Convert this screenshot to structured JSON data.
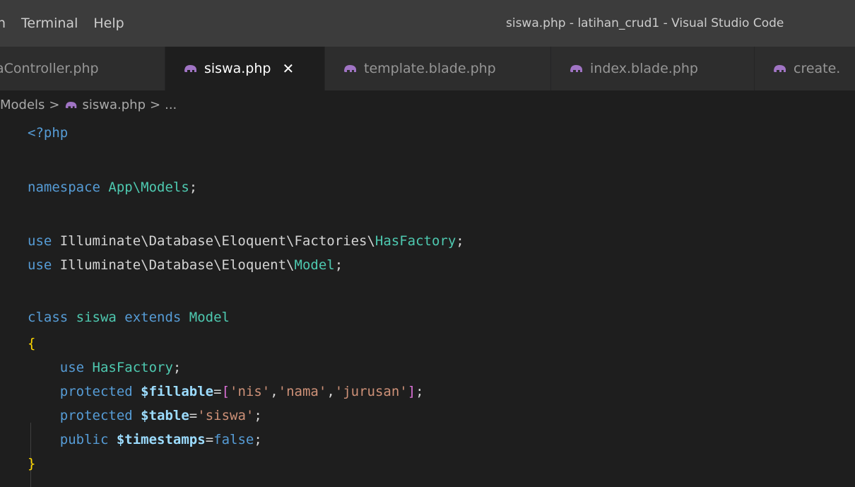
{
  "titlebar": {
    "menu": [
      "n",
      "Terminal",
      "Help"
    ],
    "window_title": "siswa.php - latihan_crud1 - Visual Studio Code"
  },
  "tabs": [
    {
      "label": "aController.php",
      "active": false,
      "icon": ""
    },
    {
      "label": "siswa.php",
      "active": true,
      "icon": "php-elephant-icon",
      "close": "✕"
    },
    {
      "label": "template.blade.php",
      "active": false,
      "icon": "php-elephant-icon"
    },
    {
      "label": "index.blade.php",
      "active": false,
      "icon": "php-elephant-icon"
    },
    {
      "label": "create.",
      "active": false,
      "icon": "php-elephant-icon"
    }
  ],
  "breadcrumb": {
    "folder": "Models",
    "file": "siswa.php",
    "symbol": "...",
    "separator": ">"
  },
  "editor": {
    "lines": [
      [
        {
          "t": "<?php",
          "c": "kw"
        }
      ],
      [],
      [
        {
          "t": "namespace ",
          "c": "kw"
        },
        {
          "t": "App\\Models",
          "c": "cls"
        },
        {
          "t": ";",
          "c": "pun"
        }
      ],
      [],
      [
        {
          "t": "use ",
          "c": "kw"
        },
        {
          "t": "Illuminate\\Database\\Eloquent\\Factories\\",
          "c": "pun"
        },
        {
          "t": "HasFactory",
          "c": "cls"
        },
        {
          "t": ";",
          "c": "pun"
        }
      ],
      [
        {
          "t": "use ",
          "c": "kw"
        },
        {
          "t": "Illuminate\\Database\\Eloquent\\",
          "c": "pun"
        },
        {
          "t": "Model",
          "c": "cls"
        },
        {
          "t": ";",
          "c": "pun"
        }
      ],
      [],
      [
        {
          "t": "class ",
          "c": "kw"
        },
        {
          "t": "siswa ",
          "c": "cls"
        },
        {
          "t": "extends ",
          "c": "kw"
        },
        {
          "t": "Model",
          "c": "cls"
        }
      ],
      [
        {
          "t": "{",
          "c": "brace"
        }
      ],
      [
        {
          "t": "    use ",
          "c": "kw"
        },
        {
          "t": "HasFactory",
          "c": "cls"
        },
        {
          "t": ";",
          "c": "pun"
        }
      ],
      [
        {
          "t": "    protected ",
          "c": "kw"
        },
        {
          "t": "$fillable",
          "c": "var"
        },
        {
          "t": "=",
          "c": "pun"
        },
        {
          "t": "[",
          "c": "brk"
        },
        {
          "t": "'nis'",
          "c": "str"
        },
        {
          "t": ",",
          "c": "pun"
        },
        {
          "t": "'nama'",
          "c": "str"
        },
        {
          "t": ",",
          "c": "pun"
        },
        {
          "t": "'jurusan'",
          "c": "str"
        },
        {
          "t": "]",
          "c": "brk"
        },
        {
          "t": ";",
          "c": "pun"
        }
      ],
      [
        {
          "t": "    protected ",
          "c": "kw"
        },
        {
          "t": "$table",
          "c": "var"
        },
        {
          "t": "=",
          "c": "pun"
        },
        {
          "t": "'siswa'",
          "c": "str"
        },
        {
          "t": ";",
          "c": "pun"
        }
      ],
      [
        {
          "t": "    public ",
          "c": "kw"
        },
        {
          "t": "$timestamps",
          "c": "var"
        },
        {
          "t": "=",
          "c": "pun"
        },
        {
          "t": "false",
          "c": "kw"
        },
        {
          "t": ";",
          "c": "pun"
        }
      ],
      [
        {
          "t": "}",
          "c": "brace"
        }
      ]
    ]
  },
  "colors": {
    "titlebar": "#3c3c3c",
    "tabbar": "#252526",
    "editor_bg": "#1e1e1e",
    "php_icon": "#a074c4"
  }
}
